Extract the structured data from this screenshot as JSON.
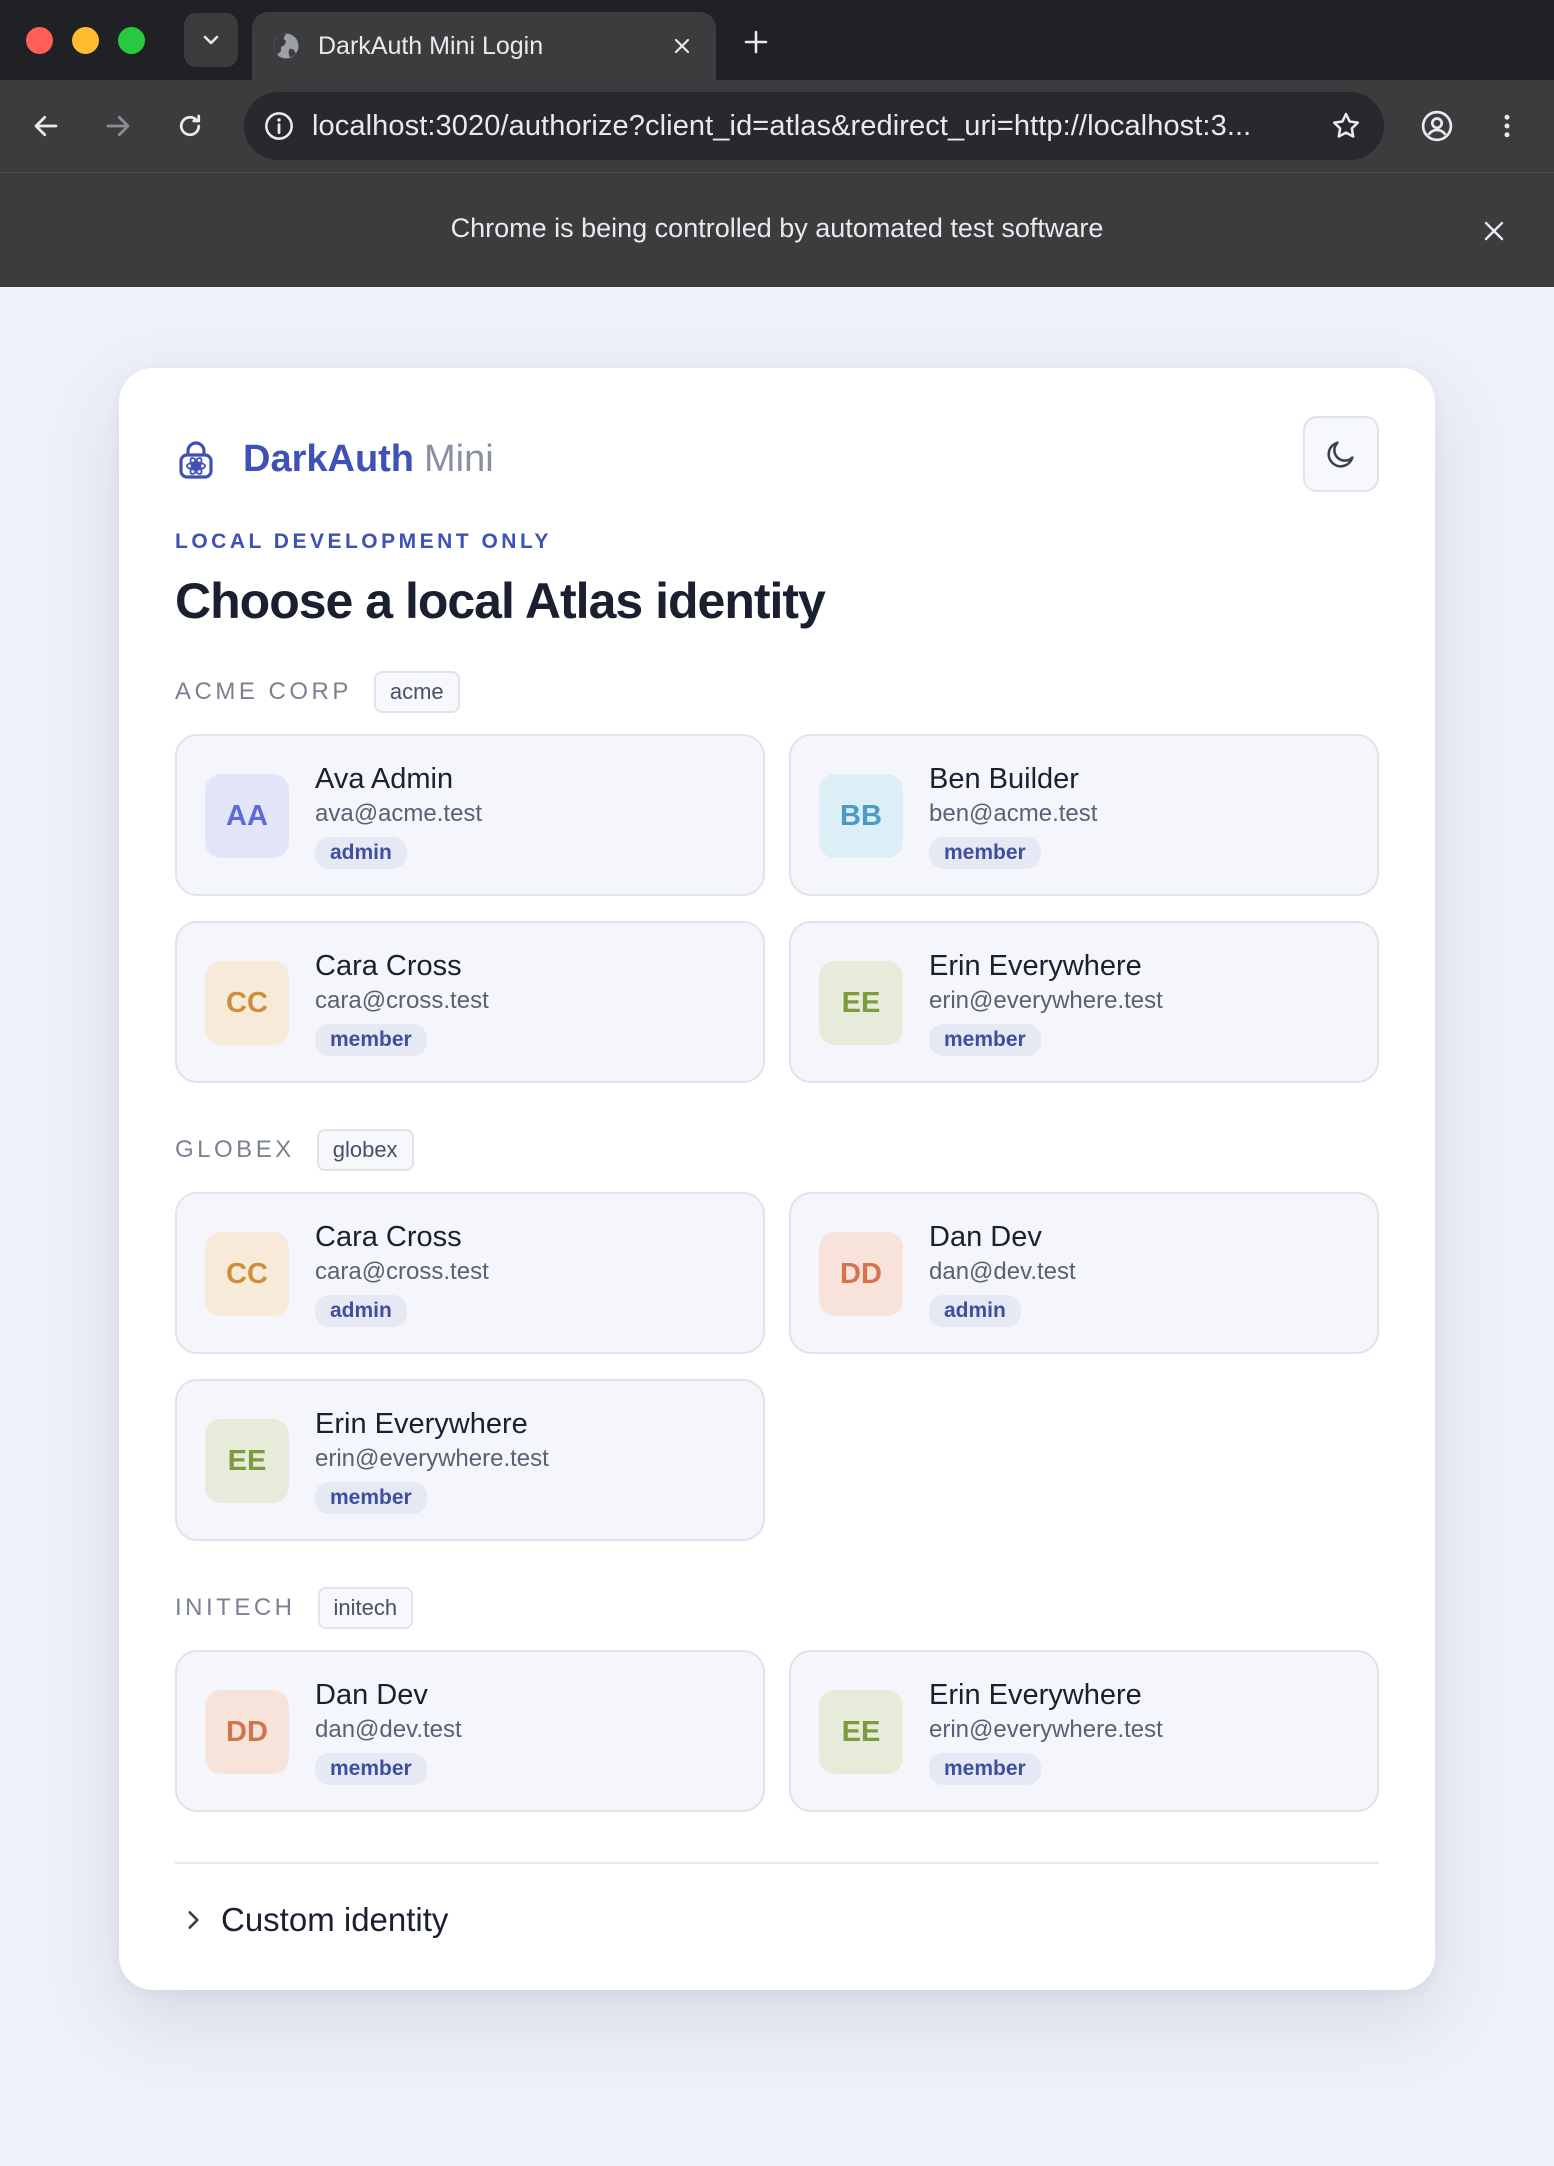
{
  "browser": {
    "tab_title": "DarkAuth Mini Login",
    "url": "localhost:3020/authorize?client_id=atlas&redirect_uri=http://localhost:3...",
    "infobar_text": "Chrome is being controlled by automated test software"
  },
  "header": {
    "brand_name": "DarkAuth",
    "brand_suffix": "Mini",
    "eyebrow": "LOCAL DEVELOPMENT ONLY",
    "title": "Choose a local Atlas identity"
  },
  "colors": {
    "accent": "#3f51b5",
    "avatar_aa_bg": "#e3e5fa",
    "avatar_aa_fg": "#5c6bd6",
    "avatar_bb_bg": "#dceef6",
    "avatar_bb_fg": "#4a9bc7",
    "avatar_cc_bg": "#f8ead8",
    "avatar_cc_fg": "#cf8f3a",
    "avatar_ee_bg": "#e6ecd9",
    "avatar_ee_fg": "#7d9a3e",
    "avatar_dd_bg": "#f8e3da",
    "avatar_dd_fg": "#d2744f"
  },
  "icons": {
    "brand": "lock-icon",
    "theme": "moon-icon",
    "custom": "chevron-right-icon"
  },
  "groups": [
    {
      "name": "ACME CORP",
      "slug": "acme",
      "identities": [
        {
          "initials": "AA",
          "name": "Ava Admin",
          "email": "ava@acme.test",
          "role": "admin"
        },
        {
          "initials": "BB",
          "name": "Ben Builder",
          "email": "ben@acme.test",
          "role": "member"
        },
        {
          "initials": "CC",
          "name": "Cara Cross",
          "email": "cara@cross.test",
          "role": "member"
        },
        {
          "initials": "EE",
          "name": "Erin Everywhere",
          "email": "erin@everywhere.test",
          "role": "member"
        }
      ]
    },
    {
      "name": "GLOBEX",
      "slug": "globex",
      "identities": [
        {
          "initials": "CC",
          "name": "Cara Cross",
          "email": "cara@cross.test",
          "role": "admin"
        },
        {
          "initials": "DD",
          "name": "Dan Dev",
          "email": "dan@dev.test",
          "role": "admin"
        },
        {
          "initials": "EE",
          "name": "Erin Everywhere",
          "email": "erin@everywhere.test",
          "role": "member"
        }
      ]
    },
    {
      "name": "INITECH",
      "slug": "initech",
      "identities": [
        {
          "initials": "DD",
          "name": "Dan Dev",
          "email": "dan@dev.test",
          "role": "member"
        },
        {
          "initials": "EE",
          "name": "Erin Everywhere",
          "email": "erin@everywhere.test",
          "role": "member"
        }
      ]
    }
  ],
  "custom_identity": {
    "label": "Custom identity"
  }
}
